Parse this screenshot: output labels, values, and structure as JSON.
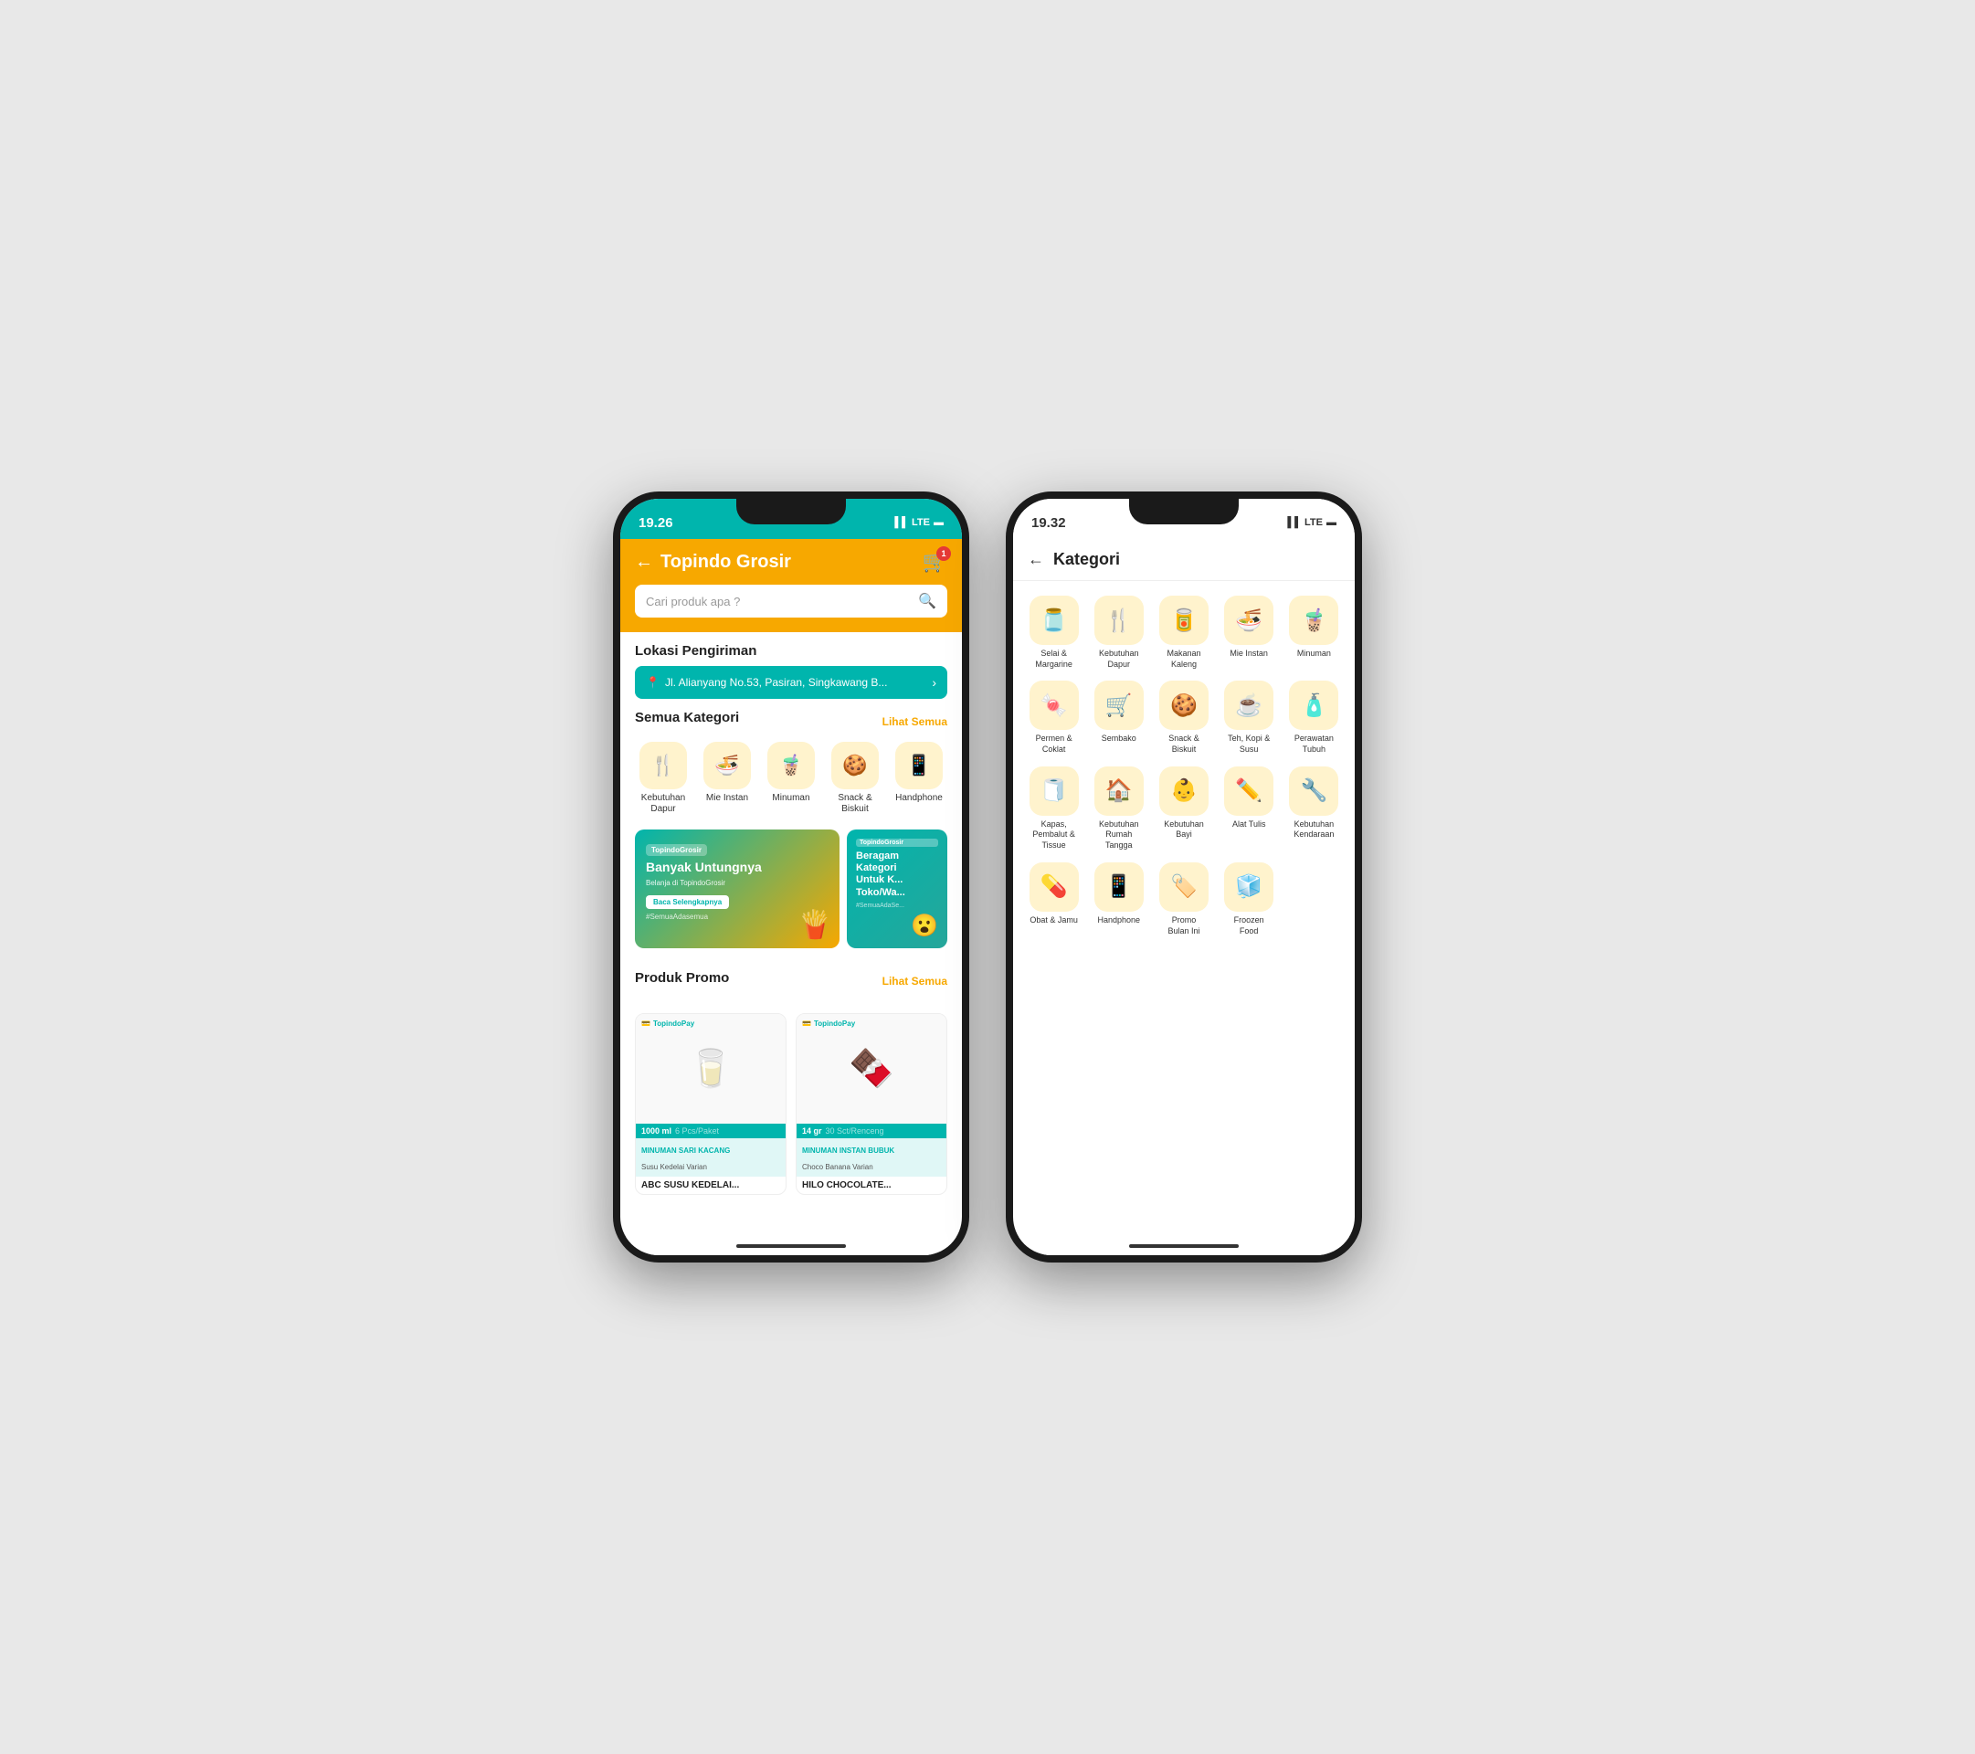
{
  "phone1": {
    "status_time": "19.26",
    "signal": "▌▌ LTE",
    "header": {
      "back": "←",
      "title": "Topindo Grosir",
      "cart_badge": "1"
    },
    "search": {
      "placeholder": "Cari produk apa ?"
    },
    "location": {
      "label": "Lokasi Pengiriman",
      "address": "Jl. Alianyang No.53, Pasiran, Singkawang B..."
    },
    "categories": {
      "title": "Semua Kategori",
      "lihat_semua": "Lihat Semua",
      "items": [
        {
          "label": "Kebutuhan Dapur",
          "icon": "🍴"
        },
        {
          "label": "Mie Instan",
          "icon": "🍜"
        },
        {
          "label": "Minuman",
          "icon": "🧋"
        },
        {
          "label": "Snack & Biskuit",
          "icon": "🗃️"
        },
        {
          "label": "Handphone",
          "icon": "📱"
        }
      ]
    },
    "banner_main": {
      "tag": "TopindoGrosir",
      "headline": "Banyak Untungnya",
      "sub": "Belanja di TopindoGrosir",
      "btn": "Baca Selengkapnya",
      "hashtag": "#SemuaAdasemua"
    },
    "banner_secondary": {
      "tag": "TopindoGrosir",
      "line1": "Beragam",
      "line2": "Kategori",
      "line3": "Untuk K...",
      "line4": "Toko/Wa...",
      "hashtag": "#SemuaAdaSe..."
    },
    "promo": {
      "title": "Produk Promo",
      "lihat_semua": "Lihat Semua",
      "items": [
        {
          "badge": "TopindoPay",
          "volume": "1000 ml",
          "unit_label": "6 Pcs/Paket",
          "tag_name": "MINUMAN SARI KACANG",
          "sub_tag": "Susu Kedelai Varian",
          "product_name": "ABC SUSU KEDELAI...",
          "icon": "🥛"
        },
        {
          "badge": "TopindoPay",
          "volume": "14 gr",
          "unit_label": "30 Sct/Renceng",
          "tag_name": "MINUMAN INSTAN BUBUK",
          "sub_tag": "Choco Banana Varian",
          "product_name": "HILO CHOCOLATE...",
          "icon": "🍫"
        }
      ]
    }
  },
  "phone2": {
    "status_time": "19.32",
    "signal": "▌▌ LTE",
    "header": {
      "back": "←",
      "title": "Kategori"
    },
    "categories": [
      {
        "label": "Selai & Margarine",
        "icon": "🫙"
      },
      {
        "label": "Kebutuhan Dapur",
        "icon": "🍴"
      },
      {
        "label": "Makanan Kaleng",
        "icon": "🥫"
      },
      {
        "label": "Mie Instan",
        "icon": "🍜"
      },
      {
        "label": "Minuman",
        "icon": "🧋"
      },
      {
        "label": "Permen & Coklat",
        "icon": "🍬"
      },
      {
        "label": "Sembako",
        "icon": "🛒"
      },
      {
        "label": "Snack & Biskuit",
        "icon": "🍪"
      },
      {
        "label": "Teh, Kopi & Susu",
        "icon": "☕"
      },
      {
        "label": "Perawatan Tubuh",
        "icon": "🧴"
      },
      {
        "label": "Kapas, Pembalut & Tissue",
        "icon": "🧻"
      },
      {
        "label": "Kebutuhan Rumah Tangga",
        "icon": "🏠"
      },
      {
        "label": "Kebutuhan Bayi",
        "icon": "👶"
      },
      {
        "label": "Alat Tulis",
        "icon": "✏️"
      },
      {
        "label": "Kebutuhan Kendaraan",
        "icon": "🔧"
      },
      {
        "label": "Obat & Jamu",
        "icon": "💊"
      },
      {
        "label": "Handphone",
        "icon": "📱"
      },
      {
        "label": "Promo Bulan Ini",
        "icon": "🏷️"
      },
      {
        "label": "Froozen Food",
        "icon": "🧊"
      }
    ]
  }
}
